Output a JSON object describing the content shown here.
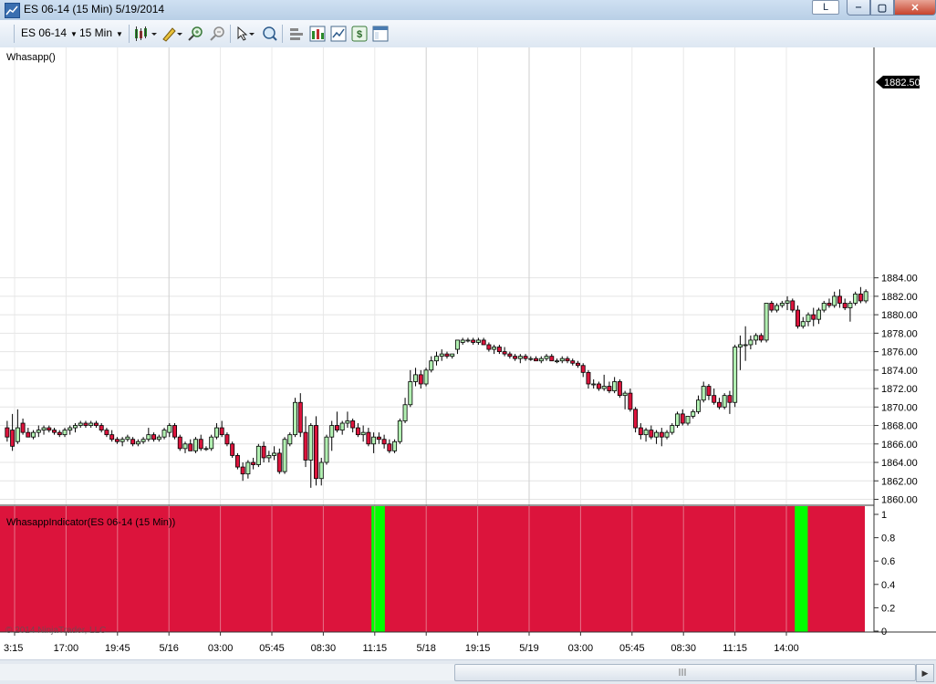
{
  "window": {
    "title": "ES 06-14 (15 Min)  5/19/2014",
    "buttons": {
      "l": "L",
      "minimize": "‒",
      "maximize": "▢",
      "close": "✕"
    }
  },
  "toolbar": {
    "instrument": "ES 06-14",
    "interval": "15 Min",
    "icons": [
      "candlestick-style-icon",
      "pencil-draw-icon",
      "zoom-in-icon",
      "zoom-out-icon",
      "cursor-pointer-icon",
      "magnifier-icon",
      "properties-icon",
      "bar-chart-icon",
      "line-chart-icon",
      "dollar-order-icon",
      "data-box-icon"
    ]
  },
  "main_panel": {
    "label": "Whasapp()",
    "last_price": "1882.50",
    "price_labels": [
      "1884.00",
      "1882.00",
      "1880.00",
      "1878.00",
      "1876.00",
      "1874.00",
      "1872.00",
      "1870.00",
      "1868.00",
      "1866.00",
      "1864.00",
      "1862.00",
      "1860.00"
    ]
  },
  "indicator_panel": {
    "label": "WhasappIndicator(ES 06-14 (15 Min))",
    "scale_labels": [
      "1",
      "0.8",
      "0.6",
      "0.4",
      "0.2",
      "0"
    ],
    "copyright": "© 2014 NinjaTrader, LLC",
    "colors": {
      "negative": "#dc143c",
      "positive": "#00ff00"
    },
    "positive_bars": [
      {
        "start": 0.4295,
        "end": 0.445
      },
      {
        "start": 0.919,
        "end": 0.934
      }
    ]
  },
  "time_axis": {
    "labels": [
      "3:15",
      "17:00",
      "19:45",
      "5/16",
      "03:00",
      "05:45",
      "08:30",
      "11:15",
      "5/18",
      "19:15",
      "5/19",
      "03:00",
      "05:45",
      "08:30",
      "11:15",
      "14:00"
    ]
  },
  "chart_data": {
    "type": "candlestick",
    "instrument": "ES 06-14",
    "interval": "15 Min",
    "ylim": [
      1860,
      1884
    ],
    "x_tick_labels": [
      "3:15",
      "17:00",
      "19:45",
      "5/16",
      "03:00",
      "05:45",
      "08:30",
      "11:15",
      "5/18",
      "19:15",
      "5/19",
      "03:00",
      "05:45",
      "08:30",
      "11:15",
      "14:00"
    ],
    "candles": [
      {
        "o": 1867.75,
        "h": 1868.5,
        "l": 1866.25,
        "c": 1866.75
      },
      {
        "o": 1867.5,
        "h": 1869.25,
        "l": 1865.25,
        "c": 1865.75
      },
      {
        "o": 1866.25,
        "h": 1869.75,
        "l": 1866.0,
        "c": 1867.75
      },
      {
        "o": 1868.25,
        "h": 1868.75,
        "l": 1867.0,
        "c": 1867.25
      },
      {
        "o": 1867.25,
        "h": 1867.75,
        "l": 1866.75,
        "c": 1866.75
      },
      {
        "o": 1866.75,
        "h": 1867.5,
        "l": 1866.5,
        "c": 1867.25
      },
      {
        "o": 1867.25,
        "h": 1868.0,
        "l": 1866.75,
        "c": 1867.5
      },
      {
        "o": 1867.5,
        "h": 1868.0,
        "l": 1867.0,
        "c": 1867.75
      },
      {
        "o": 1867.75,
        "h": 1868.0,
        "l": 1867.25,
        "c": 1867.5
      },
      {
        "o": 1867.5,
        "h": 1867.75,
        "l": 1867.0,
        "c": 1867.25
      },
      {
        "o": 1867.25,
        "h": 1867.5,
        "l": 1866.75,
        "c": 1867.0
      },
      {
        "o": 1867.0,
        "h": 1867.75,
        "l": 1866.75,
        "c": 1867.5
      },
      {
        "o": 1867.5,
        "h": 1868.0,
        "l": 1867.0,
        "c": 1867.75
      },
      {
        "o": 1867.75,
        "h": 1868.25,
        "l": 1867.25,
        "c": 1868.0
      },
      {
        "o": 1868.0,
        "h": 1868.5,
        "l": 1867.75,
        "c": 1868.25
      },
      {
        "o": 1868.25,
        "h": 1868.5,
        "l": 1867.75,
        "c": 1868.0
      },
      {
        "o": 1868.0,
        "h": 1868.5,
        "l": 1867.75,
        "c": 1868.25
      },
      {
        "o": 1868.25,
        "h": 1868.5,
        "l": 1867.75,
        "c": 1868.0
      },
      {
        "o": 1868.0,
        "h": 1868.25,
        "l": 1867.25,
        "c": 1867.5
      },
      {
        "o": 1867.5,
        "h": 1867.75,
        "l": 1866.75,
        "c": 1867.0
      },
      {
        "o": 1867.0,
        "h": 1867.5,
        "l": 1866.25,
        "c": 1866.5
      },
      {
        "o": 1866.5,
        "h": 1866.75,
        "l": 1866.0,
        "c": 1866.25
      },
      {
        "o": 1866.25,
        "h": 1866.75,
        "l": 1865.75,
        "c": 1866.5
      },
      {
        "o": 1866.5,
        "h": 1867.0,
        "l": 1866.25,
        "c": 1866.75
      },
      {
        "o": 1866.5,
        "h": 1866.75,
        "l": 1865.75,
        "c": 1866.0
      },
      {
        "o": 1866.0,
        "h": 1866.5,
        "l": 1865.75,
        "c": 1866.25
      },
      {
        "o": 1866.25,
        "h": 1866.75,
        "l": 1866.0,
        "c": 1866.5
      },
      {
        "o": 1866.5,
        "h": 1867.75,
        "l": 1866.25,
        "c": 1867.0
      },
      {
        "o": 1867.0,
        "h": 1867.25,
        "l": 1866.25,
        "c": 1866.5
      },
      {
        "o": 1866.5,
        "h": 1867.0,
        "l": 1866.25,
        "c": 1866.75
      },
      {
        "o": 1866.75,
        "h": 1867.75,
        "l": 1866.5,
        "c": 1867.5
      },
      {
        "o": 1867.25,
        "h": 1868.25,
        "l": 1866.75,
        "c": 1868.0
      },
      {
        "o": 1868.0,
        "h": 1868.25,
        "l": 1866.5,
        "c": 1866.75
      },
      {
        "o": 1866.75,
        "h": 1867.0,
        "l": 1865.25,
        "c": 1865.5
      },
      {
        "o": 1865.5,
        "h": 1866.25,
        "l": 1865.0,
        "c": 1866.0
      },
      {
        "o": 1866.0,
        "h": 1866.5,
        "l": 1865.25,
        "c": 1865.25
      },
      {
        "o": 1865.25,
        "h": 1866.75,
        "l": 1865.0,
        "c": 1866.5
      },
      {
        "o": 1866.5,
        "h": 1867.0,
        "l": 1865.25,
        "c": 1865.5
      },
      {
        "o": 1865.5,
        "h": 1865.75,
        "l": 1865.25,
        "c": 1865.5
      },
      {
        "o": 1865.5,
        "h": 1867.0,
        "l": 1865.25,
        "c": 1866.75
      },
      {
        "o": 1866.75,
        "h": 1868.25,
        "l": 1866.5,
        "c": 1867.75
      },
      {
        "o": 1867.75,
        "h": 1868.5,
        "l": 1866.75,
        "c": 1867.0
      },
      {
        "o": 1867.0,
        "h": 1867.25,
        "l": 1865.75,
        "c": 1866.0
      },
      {
        "o": 1866.0,
        "h": 1866.25,
        "l": 1864.5,
        "c": 1864.75
      },
      {
        "o": 1864.75,
        "h": 1865.0,
        "l": 1863.25,
        "c": 1863.5
      },
      {
        "o": 1863.5,
        "h": 1864.0,
        "l": 1862.0,
        "c": 1862.75
      },
      {
        "o": 1862.75,
        "h": 1864.25,
        "l": 1862.25,
        "c": 1864.0
      },
      {
        "o": 1864.0,
        "h": 1864.5,
        "l": 1863.25,
        "c": 1863.75
      },
      {
        "o": 1863.75,
        "h": 1866.0,
        "l": 1863.5,
        "c": 1865.75
      },
      {
        "o": 1865.75,
        "h": 1866.25,
        "l": 1864.0,
        "c": 1864.5
      },
      {
        "o": 1864.5,
        "h": 1865.25,
        "l": 1864.0,
        "c": 1864.75
      },
      {
        "o": 1864.75,
        "h": 1865.75,
        "l": 1864.25,
        "c": 1865.0
      },
      {
        "o": 1865.0,
        "h": 1865.5,
        "l": 1862.75,
        "c": 1863.0
      },
      {
        "o": 1863.0,
        "h": 1866.75,
        "l": 1862.75,
        "c": 1866.5
      },
      {
        "o": 1866.0,
        "h": 1867.25,
        "l": 1865.75,
        "c": 1867.0
      },
      {
        "o": 1867.0,
        "h": 1871.0,
        "l": 1866.75,
        "c": 1870.5
      },
      {
        "o": 1870.5,
        "h": 1871.5,
        "l": 1866.75,
        "c": 1867.25
      },
      {
        "o": 1867.25,
        "h": 1869.0,
        "l": 1863.5,
        "c": 1864.25
      },
      {
        "o": 1864.25,
        "h": 1868.25,
        "l": 1861.25,
        "c": 1868.0
      },
      {
        "o": 1868.0,
        "h": 1869.0,
        "l": 1861.5,
        "c": 1862.25
      },
      {
        "o": 1862.25,
        "h": 1864.5,
        "l": 1861.5,
        "c": 1864.0
      },
      {
        "o": 1864.0,
        "h": 1867.0,
        "l": 1863.75,
        "c": 1866.75
      },
      {
        "o": 1866.75,
        "h": 1868.5,
        "l": 1865.25,
        "c": 1868.0
      },
      {
        "o": 1868.0,
        "h": 1869.5,
        "l": 1867.25,
        "c": 1867.5
      },
      {
        "o": 1867.5,
        "h": 1868.5,
        "l": 1867.0,
        "c": 1868.25
      },
      {
        "o": 1868.25,
        "h": 1869.5,
        "l": 1867.75,
        "c": 1868.5
      },
      {
        "o": 1868.5,
        "h": 1868.75,
        "l": 1867.25,
        "c": 1867.75
      },
      {
        "o": 1867.75,
        "h": 1868.25,
        "l": 1866.75,
        "c": 1867.0
      },
      {
        "o": 1867.0,
        "h": 1868.0,
        "l": 1866.25,
        "c": 1867.25
      },
      {
        "o": 1867.25,
        "h": 1867.75,
        "l": 1865.75,
        "c": 1866.0
      },
      {
        "o": 1866.0,
        "h": 1867.25,
        "l": 1865.0,
        "c": 1866.75
      },
      {
        "o": 1866.75,
        "h": 1867.25,
        "l": 1866.0,
        "c": 1866.5
      },
      {
        "o": 1866.5,
        "h": 1867.0,
        "l": 1865.5,
        "c": 1866.0
      },
      {
        "o": 1866.0,
        "h": 1866.5,
        "l": 1865.0,
        "c": 1865.25
      },
      {
        "o": 1865.25,
        "h": 1866.5,
        "l": 1865.0,
        "c": 1866.25
      },
      {
        "o": 1866.25,
        "h": 1868.75,
        "l": 1866.0,
        "c": 1868.5
      },
      {
        "o": 1868.5,
        "h": 1871.0,
        "l": 1868.25,
        "c": 1870.25
      },
      {
        "o": 1870.25,
        "h": 1874.0,
        "l": 1870.0,
        "c": 1872.75
      },
      {
        "o": 1872.75,
        "h": 1874.25,
        "l": 1872.25,
        "c": 1873.5
      },
      {
        "o": 1873.5,
        "h": 1874.0,
        "l": 1872.0,
        "c": 1872.5
      },
      {
        "o": 1872.5,
        "h": 1874.25,
        "l": 1872.25,
        "c": 1874.0
      },
      {
        "o": 1874.0,
        "h": 1875.5,
        "l": 1873.75,
        "c": 1875.0
      },
      {
        "o": 1875.0,
        "h": 1876.0,
        "l": 1874.5,
        "c": 1875.5
      },
      {
        "o": 1875.5,
        "h": 1876.25,
        "l": 1875.0,
        "c": 1875.75
      },
      {
        "o": 1875.75,
        "h": 1876.0,
        "l": 1875.25,
        "c": 1875.5
      },
      {
        "o": 1875.5,
        "h": 1875.75,
        "l": 1875.25,
        "c": 1875.75
      },
      {
        "o": 1876.25,
        "h": 1877.25,
        "l": 1875.75,
        "c": 1877.25
      },
      {
        "o": 1877.0,
        "h": 1877.5,
        "l": 1876.75,
        "c": 1877.25
      },
      {
        "o": 1877.25,
        "h": 1877.5,
        "l": 1877.0,
        "c": 1877.25
      },
      {
        "o": 1877.25,
        "h": 1877.5,
        "l": 1876.75,
        "c": 1877.0
      },
      {
        "o": 1877.0,
        "h": 1877.5,
        "l": 1876.75,
        "c": 1877.25
      },
      {
        "o": 1877.25,
        "h": 1877.5,
        "l": 1876.75,
        "c": 1876.75
      },
      {
        "o": 1876.75,
        "h": 1877.0,
        "l": 1876.0,
        "c": 1876.25
      },
      {
        "o": 1876.25,
        "h": 1876.75,
        "l": 1875.75,
        "c": 1876.5
      },
      {
        "o": 1876.5,
        "h": 1876.75,
        "l": 1875.75,
        "c": 1876.0
      },
      {
        "o": 1876.0,
        "h": 1876.5,
        "l": 1875.5,
        "c": 1875.75
      },
      {
        "o": 1875.75,
        "h": 1876.0,
        "l": 1875.25,
        "c": 1875.5
      },
      {
        "o": 1875.5,
        "h": 1875.75,
        "l": 1875.0,
        "c": 1875.25
      },
      {
        "o": 1875.25,
        "h": 1875.75,
        "l": 1874.75,
        "c": 1875.5
      },
      {
        "o": 1875.5,
        "h": 1875.75,
        "l": 1875.0,
        "c": 1875.25
      },
      {
        "o": 1875.25,
        "h": 1875.5,
        "l": 1875.0,
        "c": 1875.25
      },
      {
        "o": 1875.25,
        "h": 1875.5,
        "l": 1875.0,
        "c": 1875.0
      },
      {
        "o": 1875.0,
        "h": 1875.5,
        "l": 1874.75,
        "c": 1875.25
      },
      {
        "o": 1875.25,
        "h": 1875.75,
        "l": 1875.0,
        "c": 1875.5
      },
      {
        "o": 1875.5,
        "h": 1875.75,
        "l": 1875.0,
        "c": 1875.0
      },
      {
        "o": 1875.0,
        "h": 1875.25,
        "l": 1874.75,
        "c": 1875.0
      },
      {
        "o": 1875.0,
        "h": 1875.5,
        "l": 1874.75,
        "c": 1875.25
      },
      {
        "o": 1875.25,
        "h": 1875.5,
        "l": 1874.75,
        "c": 1875.0
      },
      {
        "o": 1875.0,
        "h": 1875.25,
        "l": 1874.5,
        "c": 1874.75
      },
      {
        "o": 1874.75,
        "h": 1875.0,
        "l": 1874.25,
        "c": 1874.5
      },
      {
        "o": 1874.5,
        "h": 1874.75,
        "l": 1873.25,
        "c": 1873.75
      },
      {
        "o": 1873.75,
        "h": 1874.0,
        "l": 1872.0,
        "c": 1872.5
      },
      {
        "o": 1872.5,
        "h": 1873.0,
        "l": 1872.0,
        "c": 1872.5
      },
      {
        "o": 1872.5,
        "h": 1872.75,
        "l": 1871.75,
        "c": 1872.0
      },
      {
        "o": 1872.0,
        "h": 1873.5,
        "l": 1871.75,
        "c": 1872.25
      },
      {
        "o": 1872.25,
        "h": 1872.75,
        "l": 1871.5,
        "c": 1871.75
      },
      {
        "o": 1871.75,
        "h": 1873.25,
        "l": 1871.5,
        "c": 1872.75
      },
      {
        "o": 1872.75,
        "h": 1873.0,
        "l": 1871.0,
        "c": 1871.25
      },
      {
        "o": 1871.25,
        "h": 1871.75,
        "l": 1869.75,
        "c": 1871.5
      },
      {
        "o": 1871.5,
        "h": 1872.0,
        "l": 1869.5,
        "c": 1869.75
      },
      {
        "o": 1869.75,
        "h": 1870.0,
        "l": 1867.25,
        "c": 1867.75
      },
      {
        "o": 1867.75,
        "h": 1868.25,
        "l": 1866.5,
        "c": 1867.0
      },
      {
        "o": 1867.0,
        "h": 1867.75,
        "l": 1866.25,
        "c": 1867.5
      },
      {
        "o": 1867.5,
        "h": 1868.0,
        "l": 1866.5,
        "c": 1866.75
      },
      {
        "o": 1866.75,
        "h": 1867.5,
        "l": 1866.0,
        "c": 1867.25
      },
      {
        "o": 1867.25,
        "h": 1867.75,
        "l": 1865.75,
        "c": 1866.75
      },
      {
        "o": 1866.75,
        "h": 1867.5,
        "l": 1866.5,
        "c": 1867.25
      },
      {
        "o": 1867.25,
        "h": 1868.25,
        "l": 1867.0,
        "c": 1868.0
      },
      {
        "o": 1868.0,
        "h": 1869.5,
        "l": 1867.75,
        "c": 1869.25
      },
      {
        "o": 1869.25,
        "h": 1869.75,
        "l": 1868.0,
        "c": 1868.25
      },
      {
        "o": 1868.25,
        "h": 1869.0,
        "l": 1868.0,
        "c": 1869.0
      },
      {
        "o": 1869.0,
        "h": 1869.75,
        "l": 1868.75,
        "c": 1869.5
      },
      {
        "o": 1869.5,
        "h": 1871.25,
        "l": 1869.25,
        "c": 1870.75
      },
      {
        "o": 1870.75,
        "h": 1872.75,
        "l": 1870.5,
        "c": 1872.25
      },
      {
        "o": 1872.25,
        "h": 1872.5,
        "l": 1870.75,
        "c": 1871.25
      },
      {
        "o": 1871.25,
        "h": 1872.0,
        "l": 1870.25,
        "c": 1870.5
      },
      {
        "o": 1870.5,
        "h": 1871.0,
        "l": 1869.75,
        "c": 1870.0
      },
      {
        "o": 1870.0,
        "h": 1871.5,
        "l": 1869.75,
        "c": 1871.25
      },
      {
        "o": 1871.25,
        "h": 1871.75,
        "l": 1869.25,
        "c": 1870.5
      },
      {
        "o": 1870.5,
        "h": 1876.75,
        "l": 1870.0,
        "c": 1876.5
      },
      {
        "o": 1876.5,
        "h": 1877.75,
        "l": 1874.0,
        "c": 1876.75
      },
      {
        "o": 1876.75,
        "h": 1878.75,
        "l": 1875.0,
        "c": 1876.75
      },
      {
        "o": 1876.75,
        "h": 1877.75,
        "l": 1876.25,
        "c": 1877.25
      },
      {
        "o": 1877.25,
        "h": 1878.0,
        "l": 1876.75,
        "c": 1877.75
      },
      {
        "o": 1877.75,
        "h": 1878.0,
        "l": 1877.0,
        "c": 1877.25
      },
      {
        "o": 1877.25,
        "h": 1881.25,
        "l": 1877.0,
        "c": 1881.25
      },
      {
        "o": 1881.25,
        "h": 1881.5,
        "l": 1880.25,
        "c": 1880.5
      },
      {
        "o": 1880.5,
        "h": 1881.25,
        "l": 1880.25,
        "c": 1881.0
      },
      {
        "o": 1881.0,
        "h": 1881.5,
        "l": 1880.75,
        "c": 1881.25
      },
      {
        "o": 1881.25,
        "h": 1882.0,
        "l": 1880.5,
        "c": 1881.5
      },
      {
        "o": 1881.5,
        "h": 1881.75,
        "l": 1880.25,
        "c": 1880.5
      },
      {
        "o": 1880.5,
        "h": 1881.0,
        "l": 1878.5,
        "c": 1878.75
      },
      {
        "o": 1878.75,
        "h": 1879.75,
        "l": 1878.5,
        "c": 1879.25
      },
      {
        "o": 1879.25,
        "h": 1880.25,
        "l": 1878.75,
        "c": 1880.0
      },
      {
        "o": 1880.0,
        "h": 1880.75,
        "l": 1878.75,
        "c": 1879.5
      },
      {
        "o": 1879.5,
        "h": 1880.75,
        "l": 1879.0,
        "c": 1880.5
      },
      {
        "o": 1880.5,
        "h": 1881.5,
        "l": 1880.25,
        "c": 1881.25
      },
      {
        "o": 1881.25,
        "h": 1881.75,
        "l": 1880.75,
        "c": 1881.0
      },
      {
        "o": 1881.0,
        "h": 1882.5,
        "l": 1880.75,
        "c": 1882.0
      },
      {
        "o": 1882.0,
        "h": 1882.75,
        "l": 1880.75,
        "c": 1881.25
      },
      {
        "o": 1881.25,
        "h": 1881.75,
        "l": 1880.5,
        "c": 1880.75
      },
      {
        "o": 1880.75,
        "h": 1881.5,
        "l": 1879.25,
        "c": 1881.25
      },
      {
        "o": 1881.25,
        "h": 1882.5,
        "l": 1881.0,
        "c": 1882.25
      },
      {
        "o": 1882.25,
        "h": 1883.0,
        "l": 1881.25,
        "c": 1881.5
      },
      {
        "o": 1881.5,
        "h": 1882.75,
        "l": 1881.25,
        "c": 1882.5
      }
    ],
    "indicator": {
      "name": "WhasappIndicator(ES 06-14 (15 Min))",
      "ylim": [
        0,
        1
      ],
      "ticks": [
        1,
        0.8,
        0.6,
        0.4,
        0.2,
        0
      ]
    }
  }
}
